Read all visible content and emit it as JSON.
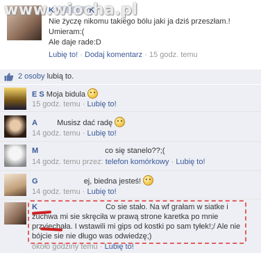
{
  "watermark": "www.wiocha.pl",
  "post": {
    "author": "Ka",
    "author_suffix": "K",
    "lines": [
      "Nie życzę nikomu takiego bólu jaki ja dziś przeszłam.!",
      "Umieram:(",
      "Ale daje rade:D"
    ],
    "meta": {
      "like": "Lubię to!",
      "comment": "Dodaj komentarz",
      "time": "15 godz. temu"
    }
  },
  "likes": {
    "text": "2 osoby",
    "suffix": "lubią to."
  },
  "comments": [
    {
      "name": "E        S",
      "text": "Moja bidula",
      "emoji": true,
      "time": "15 godz. temu",
      "via": "",
      "like": "Lubię to!"
    },
    {
      "name": "A",
      "text": "Musisz dać radę",
      "emoji": true,
      "time": "14 godz. temu",
      "via": "",
      "like": "Lubię to!"
    },
    {
      "name": "M",
      "text": "co się stanelo??;(",
      "emoji": false,
      "time": "14 godz. temu przez:",
      "via": "telefon komórkowy",
      "like": "Lubię to!"
    },
    {
      "name": "G",
      "text": "ej, biedna jesteś!",
      "emoji": true,
      "time": "14 godz. temu",
      "via": "",
      "like": "Lubię to!"
    },
    {
      "name": "K",
      "lines": [
        "Co sie stało. Na wf grałam w siatke i",
        "żuchwa mi sie skręciła w prawą strone karetka po mnie",
        "przyjechała. I wstawili mi gips od kostki po sam tyłek!;/ Ale nie",
        "bójcie sie nie długo was odwiedzę;)"
      ],
      "time": "około godziny temu",
      "via": "",
      "like": "Lubię to!"
    }
  ]
}
